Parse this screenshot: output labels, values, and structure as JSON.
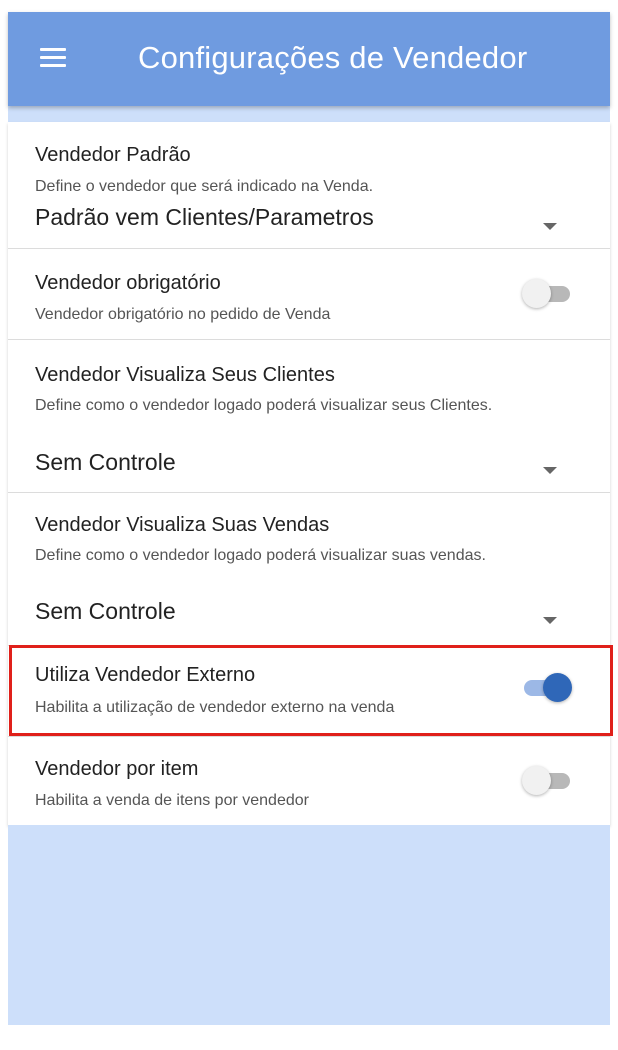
{
  "appbar": {
    "title": "Configurações de Vendedor",
    "menu_icon": "menu-icon"
  },
  "settings": {
    "vendedor_padrao": {
      "title": "Vendedor Padrão",
      "description": "Define o vendedor que será indicado na Venda.",
      "value": "Padrão vem Clientes/Parametros"
    },
    "vendedor_obrigatorio": {
      "title": "Vendedor obrigatório",
      "description": "Vendedor obrigatório no pedido de Venda",
      "enabled": false
    },
    "visualiza_clientes": {
      "title": "Vendedor Visualiza Seus Clientes",
      "description": "Define como o vendedor logado poderá visualizar seus Clientes.",
      "value": "Sem Controle"
    },
    "visualiza_vendas": {
      "title": "Vendedor Visualiza Suas Vendas",
      "description": "Define como o vendedor logado poderá visualizar suas vendas.",
      "value": "Sem Controle"
    },
    "vendedor_externo": {
      "title": "Utiliza Vendedor Externo",
      "description": "Habilita a utilização de vendedor externo na venda",
      "enabled": true
    },
    "vendedor_por_item": {
      "title": "Vendedor por item",
      "description": "Habilita a venda de itens por vendedor",
      "enabled": false
    }
  },
  "colors": {
    "appbar": "#6f9be0",
    "background": "#cddffa",
    "switch_on": "#2f67b8",
    "highlight": "#e0201a"
  }
}
